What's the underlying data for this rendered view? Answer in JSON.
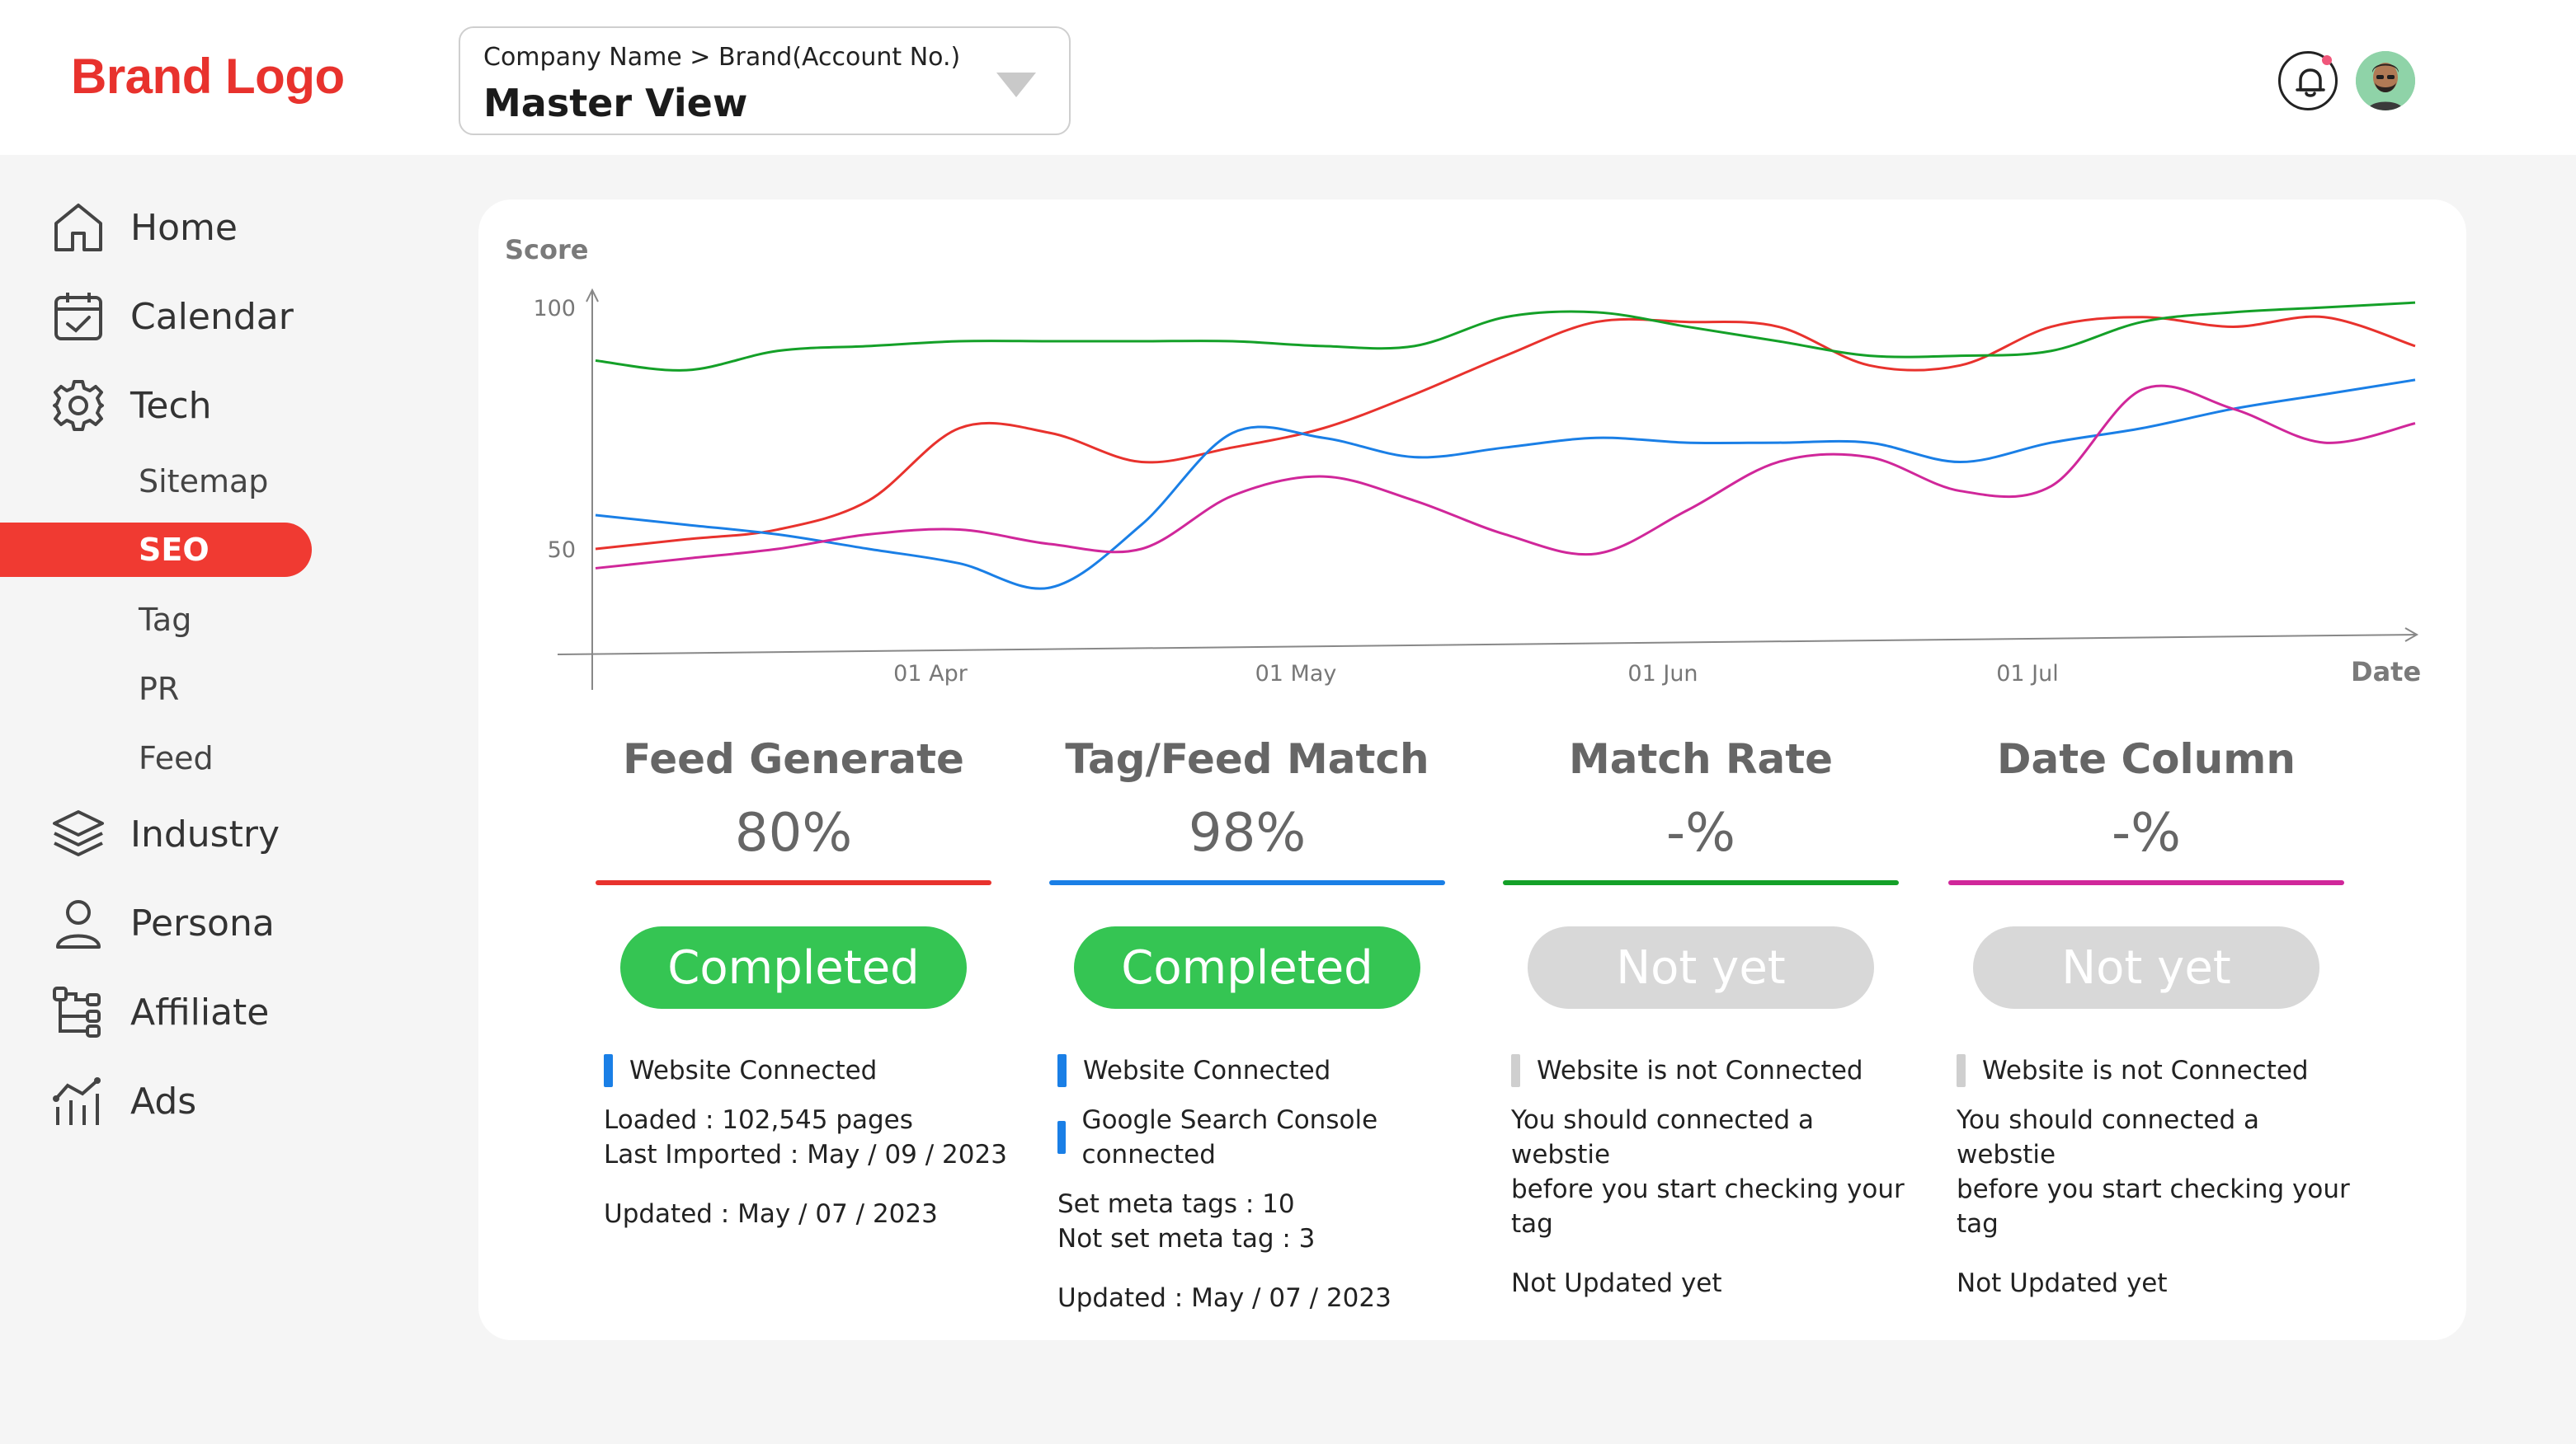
{
  "brand": {
    "logo_text": "Brand Logo"
  },
  "selector": {
    "breadcrumb": "Company Name > Brand(Account No.)",
    "view": "Master View"
  },
  "colors": {
    "accent": "#f03a32",
    "green": "#35c553",
    "red_line": "#e8322d",
    "blue_line": "#1a7fe6",
    "green_line": "#14a028",
    "magenta_line": "#d0279a"
  },
  "sidebar": {
    "items": [
      {
        "label": "Home",
        "icon": "home-icon"
      },
      {
        "label": "Calendar",
        "icon": "calendar-icon"
      },
      {
        "label": "Tech",
        "icon": "gear-icon"
      },
      {
        "label": "Industry",
        "icon": "layers-icon"
      },
      {
        "label": "Persona",
        "icon": "user-icon"
      },
      {
        "label": "Affiliate",
        "icon": "tree-icon"
      },
      {
        "label": "Ads",
        "icon": "ads-icon"
      }
    ],
    "sub_items": [
      "Sitemap",
      "SEO",
      "Tag",
      "PR",
      "Feed"
    ],
    "active_sub": "SEO"
  },
  "chart_data": {
    "type": "line",
    "ylabel": "Score",
    "xlabel": "Date",
    "yticks": [
      "100",
      "50"
    ],
    "xticks": [
      "01 Apr",
      "01 May",
      "01 Jun",
      "01 Jul"
    ],
    "x": [
      "Mar 06",
      "Mar 13",
      "Mar 20",
      "Mar 27",
      "Apr 03",
      "Apr 10",
      "Apr 17",
      "Apr 24",
      "May 01",
      "May 08",
      "May 15",
      "May 22",
      "May 29",
      "Jun 05",
      "Jun 12",
      "Jun 19",
      "Jun 26",
      "Jul 03",
      "Jul 10",
      "Jul 17",
      "Jul 24"
    ],
    "ylim": [
      30,
      105
    ],
    "series": [
      {
        "color": "#e8322d",
        "values": [
          50,
          52,
          54,
          60,
          75,
          74,
          68,
          71,
          75,
          82,
          90,
          97,
          97,
          96,
          88,
          88,
          96,
          98,
          96,
          98,
          92
        ]
      },
      {
        "color": "#1a7fe6",
        "values": [
          57,
          55,
          53,
          50,
          47,
          42,
          55,
          74,
          73,
          69,
          71,
          73,
          72,
          72,
          72,
          68,
          72,
          75,
          79,
          82,
          85
        ]
      },
      {
        "color": "#14a028",
        "values": [
          89,
          87,
          91,
          92,
          93,
          93,
          93,
          93,
          92,
          92,
          98,
          99,
          96,
          93,
          90,
          90,
          91,
          97,
          99,
          100,
          101
        ]
      },
      {
        "color": "#d0279a",
        "values": [
          46,
          48,
          50,
          53,
          54,
          51,
          50,
          61,
          65,
          60,
          53,
          49,
          58,
          68,
          69,
          62,
          63,
          83,
          79,
          72,
          76
        ]
      }
    ]
  },
  "metrics": [
    {
      "title": "Feed Generate",
      "value": "80%",
      "color": "#e8322d",
      "status": "Completed",
      "done": true,
      "tag": "Website Connected",
      "tag_color": "#1a7fe6",
      "lines1": [
        "Loaded : 102,545 pages",
        "Last Imported : May / 09 / 2023"
      ],
      "lines2": [
        "Updated : May / 07 / 2023"
      ]
    },
    {
      "title": "Tag/Feed Match",
      "value": "98%",
      "color": "#1a7fe6",
      "status": "Completed",
      "done": true,
      "tag": "Website Connected",
      "tag_color": "#1a7fe6",
      "tag2": "Google Search Console connected",
      "lines1": [
        "Set meta tags : 10",
        "Not set meta tag : 3"
      ],
      "lines2": [
        "Updated : May / 07 / 2023"
      ]
    },
    {
      "title": "Match Rate",
      "value": "-%",
      "color": "#14a028",
      "status": "Not yet",
      "done": false,
      "tag": "Website is not Connected",
      "tag_color": "#cfcfcf",
      "lines1": [
        "You should connected a webstie",
        "before you start checking your tag"
      ],
      "lines2": [
        "Not Updated yet"
      ]
    },
    {
      "title": "Date Column",
      "value": "-%",
      "color": "#d0279a",
      "status": "Not yet",
      "done": false,
      "tag": "Website is not Connected",
      "tag_color": "#cfcfcf",
      "lines1": [
        "You should connected a webstie",
        "before you start checking your tag"
      ],
      "lines2": [
        "Not Updated yet"
      ]
    }
  ]
}
